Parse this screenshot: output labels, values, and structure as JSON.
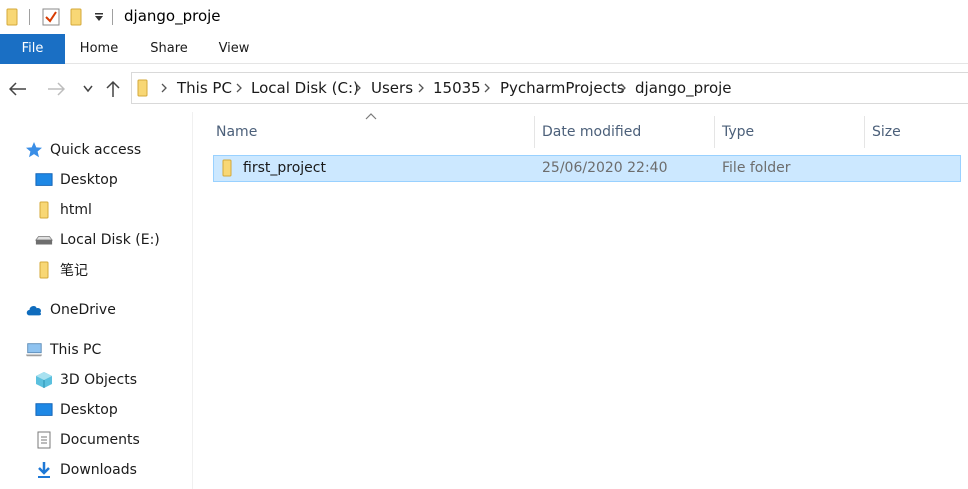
{
  "window": {
    "title": "django_proje"
  },
  "ribbon": {
    "tabs": [
      {
        "label": "File"
      },
      {
        "label": "Home"
      },
      {
        "label": "Share"
      },
      {
        "label": "View"
      }
    ]
  },
  "address": {
    "crumbs": [
      "This PC",
      "Local Disk (C:)",
      "Users",
      "15035",
      "PycharmProjects",
      "django_proje"
    ]
  },
  "nav": {
    "quick_access": "Quick access",
    "items": [
      {
        "label": "Desktop",
        "icon": "desktop-icon"
      },
      {
        "label": "html",
        "icon": "folder-icon"
      },
      {
        "label": "Local Disk (E:)",
        "icon": "drive-icon"
      },
      {
        "label": "笔记",
        "icon": "folder-icon"
      }
    ],
    "onedrive": "OneDrive",
    "this_pc": "This PC",
    "pc_items": [
      {
        "label": "3D Objects",
        "icon": "3d-objects-icon"
      },
      {
        "label": "Desktop",
        "icon": "desktop-icon"
      },
      {
        "label": "Documents",
        "icon": "documents-icon"
      },
      {
        "label": "Downloads",
        "icon": "downloads-icon"
      }
    ]
  },
  "columns": {
    "name": "Name",
    "date": "Date modified",
    "type": "Type",
    "size": "Size"
  },
  "files": [
    {
      "name": "first_project",
      "date": "25/06/2020 22:40",
      "type": "File folder",
      "size": ""
    }
  ],
  "colors": {
    "accent": "#1a6fc4",
    "selection": "#cce8ff",
    "selection_border": "#99d1ff",
    "folder": "#f8d775"
  }
}
